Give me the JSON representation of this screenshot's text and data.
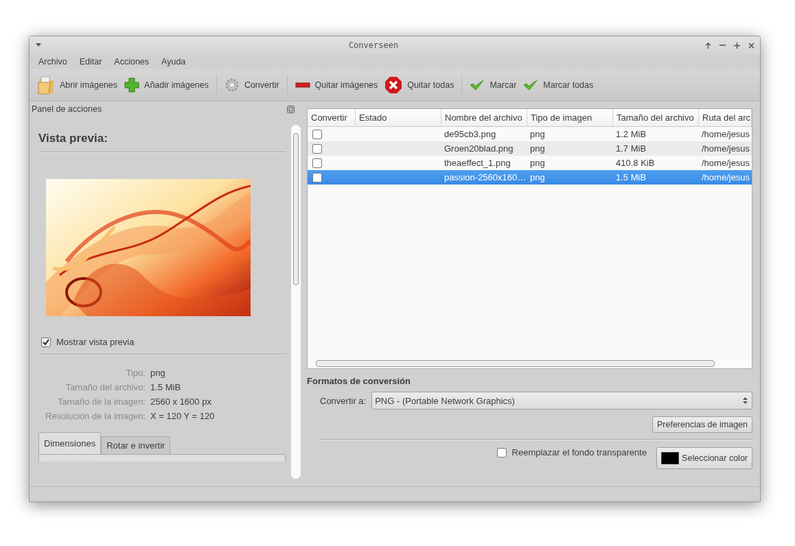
{
  "window": {
    "title": "Converseen"
  },
  "menu": [
    "Archivo",
    "Editar",
    "Acciones",
    "Ayuda"
  ],
  "toolbar": [
    [
      {
        "label": "Abrir imágenes",
        "kind": "open"
      },
      {
        "label": "Añadir imágenes",
        "kind": "add"
      }
    ],
    [
      {
        "label": "Convertir",
        "kind": "convert"
      }
    ],
    [
      {
        "label": "Quitar imágenes",
        "kind": "remove"
      },
      {
        "label": "Quitar todas",
        "kind": "removeall"
      }
    ],
    [
      {
        "label": "Marcar",
        "kind": "mark"
      },
      {
        "label": "Marcar todas",
        "kind": "mark"
      }
    ]
  ],
  "actions_panel": {
    "title": "Panel de acciones",
    "preview_heading": "Vista previa:",
    "show_preview": {
      "label": "Mostrar vista previa",
      "checked": true
    },
    "info": [
      {
        "label": "Tipo:",
        "value": "png"
      },
      {
        "label": "Tamaño del archivo:",
        "value": "1.5 MiB"
      },
      {
        "label": "Tamaño de la imagen:",
        "value": "2560 x 1600 px"
      },
      {
        "label": "Resolución de la imagen:",
        "value": "X = 120 Y = 120"
      }
    ],
    "tabs": [
      {
        "label": "Dimensiones",
        "selected": true
      },
      {
        "label": "Rotar e invertir",
        "selected": false
      }
    ]
  },
  "table": {
    "columns": [
      "Convertir",
      "Estado",
      "Nombre del archivo",
      "Tipo de imagen",
      "Tamaño del archivo",
      "Ruta del arc"
    ],
    "rows": [
      {
        "checked": false,
        "selected": false,
        "cells": [
          "",
          "",
          "de95cb3.png",
          "png",
          "1.2 MiB",
          "/home/jesus"
        ]
      },
      {
        "checked": false,
        "selected": false,
        "cells": [
          "",
          "",
          "Groen20blad.png",
          "png",
          "1.7 MiB",
          "/home/jesus"
        ]
      },
      {
        "checked": false,
        "selected": false,
        "cells": [
          "",
          "",
          "theaeffect_1.png",
          "png",
          "410.8 KiB",
          "/home/jesus"
        ]
      },
      {
        "checked": false,
        "selected": true,
        "cells": [
          "",
          "",
          "passion-2560x160…",
          "png",
          "1.5 MiB",
          "/home/jesus"
        ]
      }
    ]
  },
  "conversion": {
    "title": "Formatos de conversión",
    "convert_label": "Convertir a:",
    "format": "PNG - (Portable Network Graphics)",
    "preferences_button": "Preferencias de imagen",
    "replace_background": {
      "label": "Reemplazar el fondo transparente",
      "checked": false
    },
    "color_button": "Seleccionar color",
    "color": "#000000"
  }
}
